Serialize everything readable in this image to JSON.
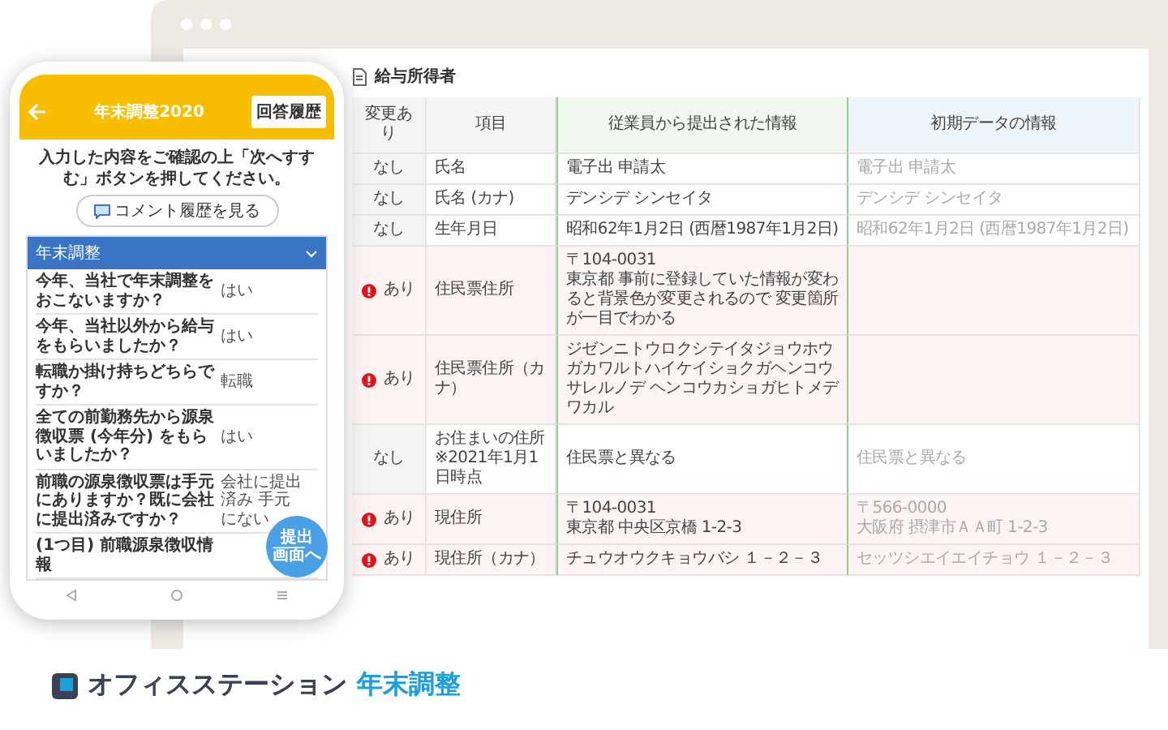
{
  "sheet": {
    "title": "給与所得者",
    "columns": [
      "変更あり",
      "項目",
      "従業員から提出された情報",
      "初期データの情報"
    ],
    "rows": [
      {
        "changed": false,
        "change_label": "なし",
        "item": [
          "氏名"
        ],
        "submitted": [
          "電子出 申請太"
        ],
        "initial": [
          "電子出 申請太"
        ]
      },
      {
        "changed": false,
        "change_label": "なし",
        "item": [
          "氏名 (カナ)"
        ],
        "submitted": [
          "デンシデ シンセイタ"
        ],
        "initial": [
          "デンシデ シンセイタ"
        ]
      },
      {
        "changed": false,
        "change_label": "なし",
        "item": [
          "生年月日"
        ],
        "submitted": [
          "昭和62年1月2日 (西暦1987年1月2日)"
        ],
        "initial": [
          "昭和62年1月2日 (西暦1987年1月2日)"
        ]
      },
      {
        "changed": true,
        "change_label": "あり",
        "item": [
          "住民票住所"
        ],
        "submitted": [
          "〒104-0031",
          "東京都 事前に登録していた情報が変わると背景色が変更されるので 変更箇所が一目でわかる"
        ]
      },
      {
        "changed": true,
        "change_label": "あり",
        "item": [
          "住民票住所（カナ）"
        ],
        "submitted": [
          "ジゼンニトウロクシテイタジョウホウガカワルトハイケイショクガヘンコウサレルノデ ヘンコウカショガヒトメデワカル"
        ]
      },
      {
        "changed": false,
        "change_label": "なし",
        "item": [
          "お住まいの住所",
          "※2021年1月1日時点"
        ],
        "submitted": [
          "住民票と異なる"
        ],
        "initial": [
          "住民票と異なる"
        ]
      },
      {
        "changed": true,
        "change_label": "あり",
        "item": [
          "現住所"
        ],
        "submitted": [
          "〒104-0031",
          "東京都 中央区京橋 1-2-3"
        ],
        "initial": [
          "〒566-0000",
          "大阪府 摂津市ＡＡ町 1-2-3"
        ]
      },
      {
        "changed": true,
        "change_label": "あり",
        "item": [
          "現住所（カナ）"
        ],
        "submitted": [
          "チュウオウクキョウバシ １－２－３"
        ],
        "initial": [
          "セッツシエイエイチョウ １－２－３"
        ]
      }
    ]
  },
  "phone": {
    "title": "年末調整2020",
    "history_button": "回答履歴",
    "instruction": "入力した内容をご確認の上「次へすすむ」ボタンを押してください。",
    "comment_button": "コメント履歴を見る",
    "section": {
      "title": "年末調整",
      "expanded": true
    },
    "items": [
      {
        "question": "今年、当社で年末調整をおこないますか？",
        "answer": "はい"
      },
      {
        "question": "今年、当社以外から給与をもらいましたか？",
        "answer": "はい"
      },
      {
        "question": "転職か掛け持ちどちらですか？",
        "answer": "転職"
      },
      {
        "question": "全ての前勤務先から源泉徴収票 (今年分) をもらいましたか？",
        "answer": "はい"
      },
      {
        "question": "前職の源泉徴収票は手元にありますか？既に会社に提出済みですか？",
        "answer": "会社に提出済み 手元にない"
      },
      {
        "question": "(1つ目) 前職源泉徴収情報"
      }
    ],
    "submit_button": [
      "提出",
      "画面へ"
    ]
  },
  "brand": {
    "name": "オフィスステーション",
    "product": "年末調整"
  }
}
